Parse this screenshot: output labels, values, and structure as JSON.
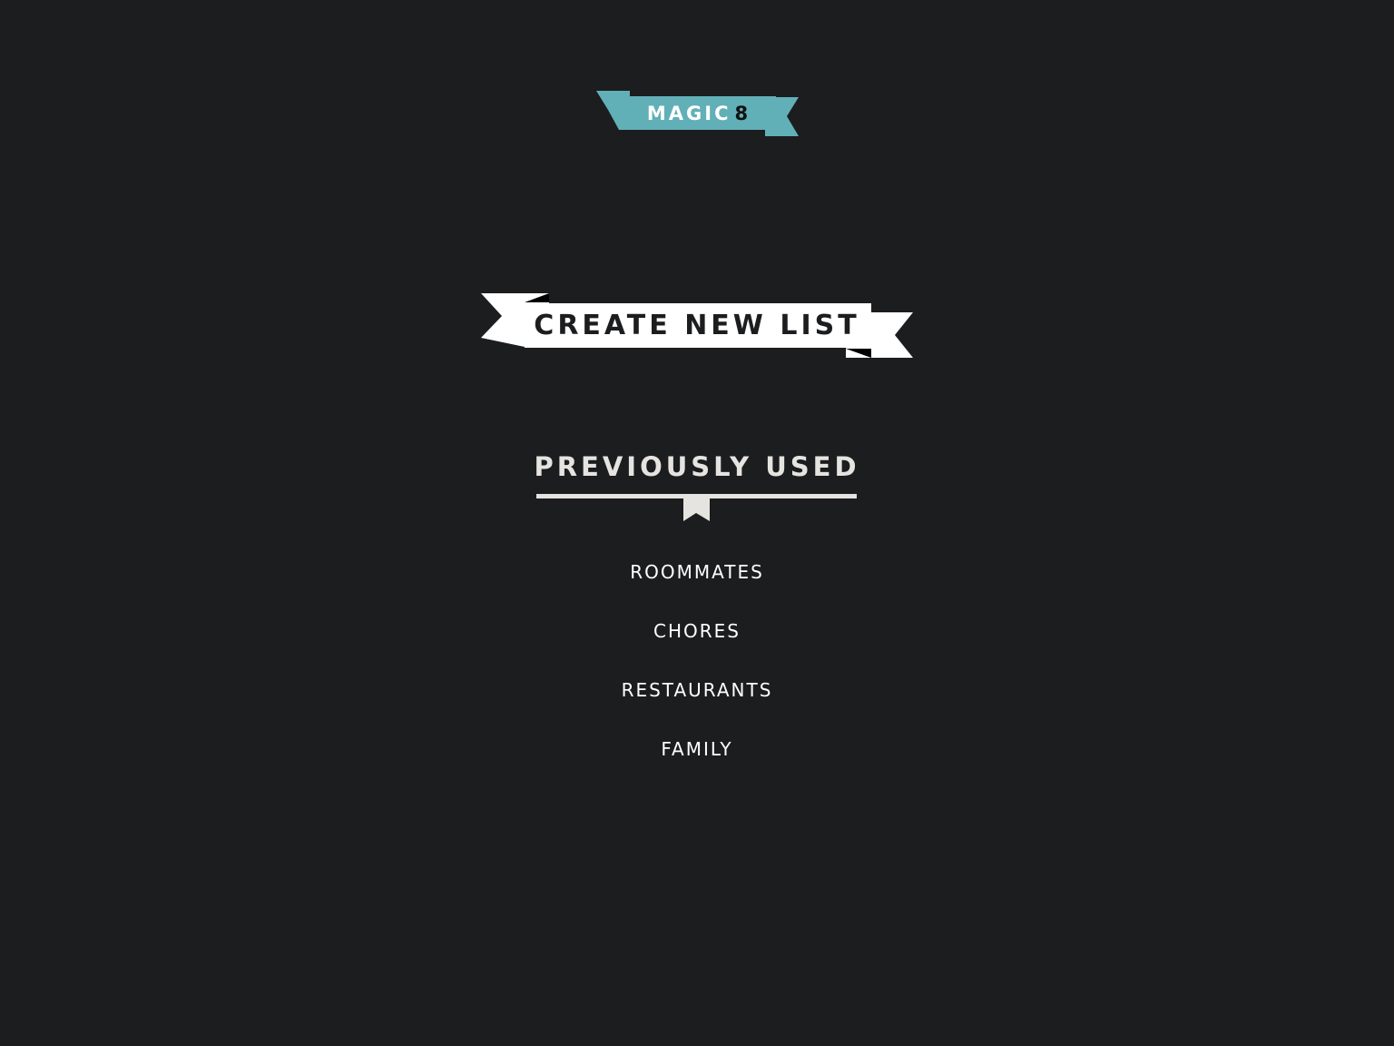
{
  "logo": {
    "text": "MAGIC",
    "number": "8"
  },
  "create_button": {
    "label": "CREATE NEW LIST"
  },
  "previously_used": {
    "heading": "PREVIOUSLY USED",
    "items": [
      {
        "label": "ROOMMATES"
      },
      {
        "label": "CHORES"
      },
      {
        "label": "RESTAURANTS"
      },
      {
        "label": "FAMILY"
      }
    ]
  },
  "colors": {
    "background": "#1c1d1f",
    "accent": "#62b0b7",
    "ribbon": "#ffffff",
    "heading": "#e6e4e0"
  }
}
